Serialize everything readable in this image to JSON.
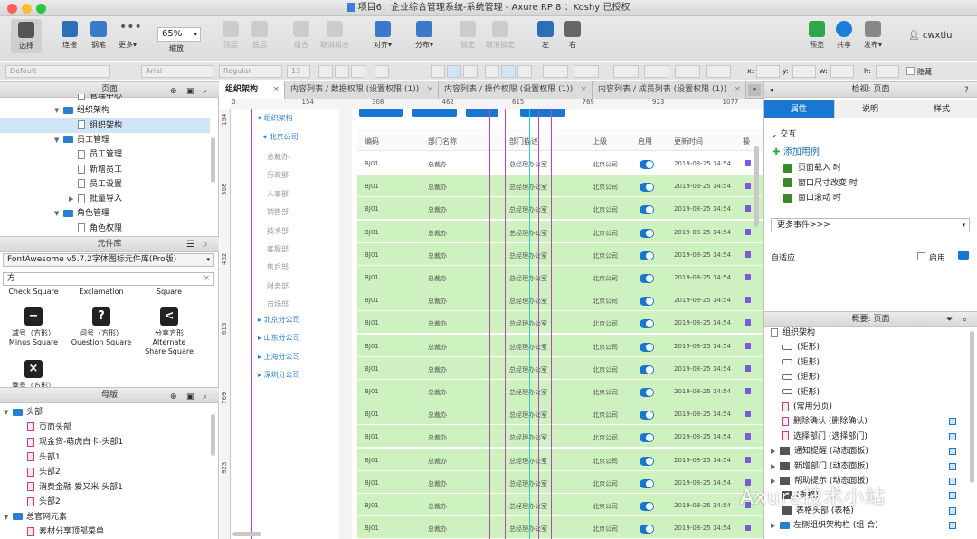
{
  "window": {
    "title": "项目6：企业综合管理系统-系统管理 - Axure RP 8 ：Koshy 已授权"
  },
  "toolbar": {
    "select": "选择",
    "connect": "连接",
    "pen": "钢笔",
    "more": "更多▾",
    "zoom_value": "65%",
    "zoom_label": "缩放",
    "top": "顶层",
    "bottom": "底层",
    "group": "组合",
    "ungroup": "取消组合",
    "align": "对齐▾",
    "distribute": "分布▾",
    "lock": "锁定",
    "unlock": "取消锁定",
    "left": "左",
    "right": "右",
    "preview": "预览",
    "share": "共享",
    "publish": "发布▾",
    "user": "cwxtlu"
  },
  "format": {
    "style": "Default",
    "font": "Arial",
    "weight": "Regular",
    "size": "13",
    "x": "x:",
    "y": "y:",
    "w": "w:",
    "h": "h:",
    "hide": "隐藏"
  },
  "pages_panel": {
    "title": "页面",
    "items": [
      {
        "label": "管理中心",
        "type": "page",
        "indent": 2
      },
      {
        "label": "组织架构",
        "type": "folder",
        "indent": 1
      },
      {
        "label": "组织架构",
        "type": "page",
        "indent": 2,
        "selected": true
      },
      {
        "label": "员工管理",
        "type": "folder",
        "indent": 1
      },
      {
        "label": "员工管理",
        "type": "page",
        "indent": 2
      },
      {
        "label": "新增员工",
        "type": "page",
        "indent": 2
      },
      {
        "label": "员工设置",
        "type": "page",
        "indent": 2
      },
      {
        "label": "批量导入",
        "type": "page",
        "indent": 2
      },
      {
        "label": "角色管理",
        "type": "folder",
        "indent": 1
      },
      {
        "label": "角色权限",
        "type": "page",
        "indent": 2
      }
    ]
  },
  "library_panel": {
    "title": "元件库",
    "selected_library": "FontAwesome v5.7.2字体图标元件库(Pro版)",
    "search_value": "方",
    "top_labels": [
      "Check Square",
      "Exclamation",
      "Square"
    ],
    "items": [
      {
        "cn": "减号（方形）",
        "en": "Minus Square",
        "glyph": "−"
      },
      {
        "cn": "问号（方形）",
        "en": "Question Square",
        "glyph": "?"
      },
      {
        "cn": "分享方形 Alternate",
        "en": "Share Square",
        "glyph": "<"
      },
      {
        "cn": "乘号（方形）",
        "en": "",
        "glyph": "×"
      }
    ]
  },
  "masters_panel": {
    "title": "母版",
    "items": [
      {
        "label": "头部",
        "type": "folder",
        "indent": 0
      },
      {
        "label": "页面头部",
        "type": "master",
        "indent": 1
      },
      {
        "label": "现金贷-萌虎白卡-头部1",
        "type": "master",
        "indent": 1
      },
      {
        "label": "头部1",
        "type": "master",
        "indent": 1
      },
      {
        "label": "头部2",
        "type": "master",
        "indent": 1
      },
      {
        "label": "消费金融-爱又米 头部1",
        "type": "master",
        "indent": 1
      },
      {
        "label": "头部2",
        "type": "master",
        "indent": 1
      },
      {
        "label": "总官网元素",
        "type": "folder",
        "indent": 0
      },
      {
        "label": "素材分享顶部菜单",
        "type": "master",
        "indent": 1
      }
    ]
  },
  "tabs": [
    {
      "label": "组织架构",
      "active": true
    },
    {
      "label": "内容列表 / 数据权限 (设置权限 (1))",
      "active": false
    },
    {
      "label": "内容列表 / 操作权限 (设置权限 (1))",
      "active": false
    },
    {
      "label": "内容列表 / 成员列表 (设置权限 (1))",
      "active": false
    }
  ],
  "ruler": {
    "x_ticks": [
      "0",
      "154",
      "308",
      "462",
      "615",
      "769",
      "923",
      "1077"
    ],
    "y_ticks": [
      "154",
      "308",
      "462",
      "615",
      "769",
      "923"
    ]
  },
  "canvas": {
    "org_title": "组织架构",
    "beijing": "北京公司",
    "departments": [
      "总裁办",
      "行政部",
      "人事部",
      "销售部",
      "技术部",
      "客服部",
      "售后部",
      "财务部",
      "市场部"
    ],
    "branches": [
      "北京分公司",
      "山东分公司",
      "上海分公司",
      "深圳分公司"
    ],
    "table_headers": [
      "编码",
      "部门名称",
      "部门描述",
      "上级",
      "启用",
      "更新时间",
      "操"
    ],
    "row": {
      "code": "BJ01",
      "name": "总裁办",
      "desc": "总经理办公室",
      "parent": "北京公司",
      "time": "2019-08-25 14:54"
    },
    "row_count": 18
  },
  "right_panel": {
    "title": "检视: 页面",
    "tabs": [
      "属性",
      "说明",
      "样式"
    ],
    "interaction": "交互",
    "add_case": "添加用例",
    "events": [
      "页面载入 时",
      "窗口尺寸改变 时",
      "窗口滚动 时"
    ],
    "more_events": "更多事件>>>",
    "adaptive": "自适应",
    "enable": "启用"
  },
  "outline_panel": {
    "title": "概要: 页面",
    "items": [
      {
        "label": "组织架构",
        "type": "root"
      },
      {
        "label": "(矩形)",
        "type": "shape"
      },
      {
        "label": "(矩形)",
        "type": "shape"
      },
      {
        "label": "(矩形)",
        "type": "shape"
      },
      {
        "label": "(矩形)",
        "type": "shape"
      },
      {
        "label": "(常用分页)",
        "type": "master"
      },
      {
        "label": "删除确认 (删除确认)",
        "type": "master"
      },
      {
        "label": "选择部门 (选择部门)",
        "type": "master"
      },
      {
        "label": "通知提醒 (动态面板)",
        "type": "dyn"
      },
      {
        "label": "新增部门 (动态面板)",
        "type": "dyn"
      },
      {
        "label": "帮助提示 (动态面板)",
        "type": "dyn"
      },
      {
        "label": "(表格)",
        "type": "dyn"
      },
      {
        "label": "表格头部 (表格)",
        "type": "dyn"
      },
      {
        "label": "左侧组织架构栏 (组 合)",
        "type": "folder"
      }
    ]
  },
  "watermark": "Axure技术小站",
  "colors": {
    "accent": "#1976d2",
    "row_green": "#cdf2c0",
    "guide": "#c040c0"
  }
}
